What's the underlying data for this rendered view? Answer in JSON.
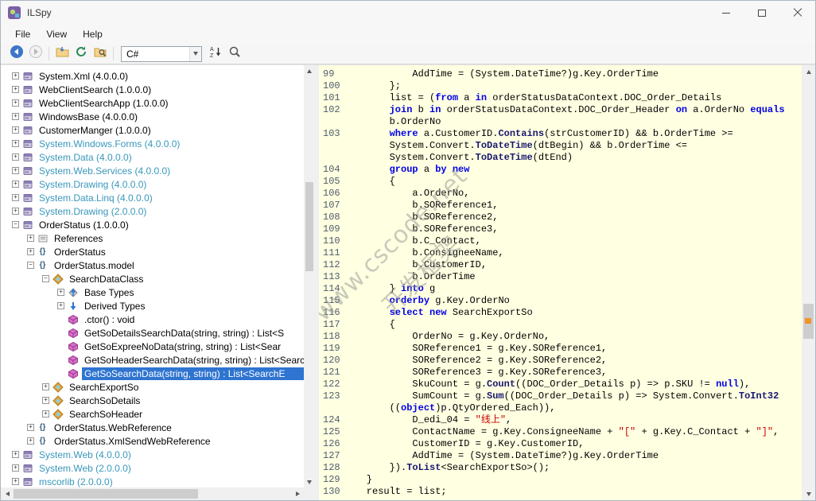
{
  "window": {
    "title": "ILSpy"
  },
  "menu": {
    "items": [
      "File",
      "View",
      "Help"
    ]
  },
  "toolbar": {
    "language": "C#"
  },
  "watermark": {
    "line1": "www.cscode.net",
    "line2": "开发框架"
  },
  "tree": {
    "items": [
      {
        "indent": 0,
        "exp": "+",
        "icon": "assembly",
        "label": "System.Xml (4.0.0.0)"
      },
      {
        "indent": 0,
        "exp": "+",
        "icon": "assembly",
        "label": "WebClientSearch (1.0.0.0)"
      },
      {
        "indent": 0,
        "exp": "+",
        "icon": "assembly",
        "label": "WebClientSearchApp (1.0.0.0)"
      },
      {
        "indent": 0,
        "exp": "+",
        "icon": "assembly",
        "label": "WindowsBase (4.0.0.0)"
      },
      {
        "indent": 0,
        "exp": "+",
        "icon": "assembly",
        "label": "CustomerManger (1.0.0.0)"
      },
      {
        "indent": 0,
        "exp": "+",
        "icon": "assembly",
        "label": "System.Windows.Forms (4.0.0.0)",
        "teal": true
      },
      {
        "indent": 0,
        "exp": "+",
        "icon": "assembly",
        "label": "System.Data (4.0.0.0)",
        "teal": true
      },
      {
        "indent": 0,
        "exp": "+",
        "icon": "assembly",
        "label": "System.Web.Services (4.0.0.0)",
        "teal": true
      },
      {
        "indent": 0,
        "exp": "+",
        "icon": "assembly",
        "label": "System.Drawing (4.0.0.0)",
        "teal": true
      },
      {
        "indent": 0,
        "exp": "+",
        "icon": "assembly",
        "label": "System.Data.Linq (4.0.0.0)",
        "teal": true
      },
      {
        "indent": 0,
        "exp": "+",
        "icon": "assembly",
        "label": "System.Drawing (2.0.0.0)",
        "teal": true
      },
      {
        "indent": 0,
        "exp": "-",
        "icon": "assembly",
        "label": "OrderStatus (1.0.0.0)"
      },
      {
        "indent": 1,
        "exp": "+",
        "icon": "references",
        "label": "References"
      },
      {
        "indent": 1,
        "exp": "+",
        "icon": "namespace",
        "label": "OrderStatus"
      },
      {
        "indent": 1,
        "exp": "-",
        "icon": "namespace",
        "label": "OrderStatus.model"
      },
      {
        "indent": 2,
        "exp": "-",
        "icon": "class",
        "label": "SearchDataClass"
      },
      {
        "indent": 3,
        "exp": "+",
        "icon": "base-types",
        "label": "Base Types"
      },
      {
        "indent": 3,
        "exp": "+",
        "icon": "derived-types",
        "label": "Derived Types"
      },
      {
        "indent": 3,
        "exp": null,
        "icon": "method",
        "label": ".ctor() : void"
      },
      {
        "indent": 3,
        "exp": null,
        "icon": "method",
        "label": "GetSoDetailsSearchData(string, string) : List<S"
      },
      {
        "indent": 3,
        "exp": null,
        "icon": "method",
        "label": "GetSoExpreeNoData(string, string) : List<Sear"
      },
      {
        "indent": 3,
        "exp": null,
        "icon": "method",
        "label": "GetSoHeaderSearchData(string, string) : List<Searc"
      },
      {
        "indent": 3,
        "exp": null,
        "icon": "method",
        "label": "GetSoSearchData(string, string) : List<SearchE",
        "selected": true
      },
      {
        "indent": 2,
        "exp": "+",
        "icon": "class",
        "label": "SearchExportSo"
      },
      {
        "indent": 2,
        "exp": "+",
        "icon": "class",
        "label": "SearchSoDetails"
      },
      {
        "indent": 2,
        "exp": "+",
        "icon": "class",
        "label": "SearchSoHeader"
      },
      {
        "indent": 1,
        "exp": "+",
        "icon": "namespace",
        "label": "OrderStatus.WebReference"
      },
      {
        "indent": 1,
        "exp": "+",
        "icon": "namespace",
        "label": "OrderStatus.XmlSendWebReference"
      },
      {
        "indent": 0,
        "exp": "+",
        "icon": "assembly",
        "label": "System.Web (4.0.0.0)",
        "teal": true
      },
      {
        "indent": 0,
        "exp": "+",
        "icon": "assembly",
        "label": "System.Web (2.0.0.0)",
        "teal": true
      },
      {
        "indent": 0,
        "exp": "+",
        "icon": "assembly",
        "label": "mscorlib (2.0.0.0)",
        "teal": true
      }
    ]
  },
  "code": {
    "lines": [
      {
        "n": "99",
        "t": [
          [
            "p",
            "            AddTime = (System.DateTime?)g.Key.OrderTime"
          ]
        ]
      },
      {
        "n": "100",
        "t": [
          [
            "p",
            "        };"
          ]
        ]
      },
      {
        "n": "101",
        "t": [
          [
            "p",
            "        list = ("
          ],
          [
            "k",
            "from"
          ],
          [
            "p",
            " a "
          ],
          [
            "k",
            "in"
          ],
          [
            "p",
            " orderStatusDataContext.DOC_Order_Details"
          ]
        ]
      },
      {
        "n": "102",
        "t": [
          [
            "p",
            "        "
          ],
          [
            "k",
            "join"
          ],
          [
            "p",
            " b "
          ],
          [
            "k",
            "in"
          ],
          [
            "p",
            " orderStatusDataContext.DOC_Order_Header "
          ],
          [
            "k",
            "on"
          ],
          [
            "p",
            " a.OrderNo "
          ],
          [
            "k",
            "equals"
          ]
        ]
      },
      {
        "n": null,
        "t": [
          [
            "p",
            "        b.OrderNo"
          ]
        ]
      },
      {
        "n": "103",
        "t": [
          [
            "p",
            "        "
          ],
          [
            "k",
            "where"
          ],
          [
            "p",
            " a.CustomerID."
          ],
          [
            "m",
            "Contains"
          ],
          [
            "p",
            "(strCustomerID) && b.OrderTime >="
          ]
        ]
      },
      {
        "n": null,
        "t": [
          [
            "p",
            "        System.Convert."
          ],
          [
            "m",
            "ToDateTime"
          ],
          [
            "p",
            "(dtBegin) && b.OrderTime <="
          ]
        ]
      },
      {
        "n": null,
        "t": [
          [
            "p",
            "        System.Convert."
          ],
          [
            "m",
            "ToDateTime"
          ],
          [
            "p",
            "(dtEnd)"
          ]
        ]
      },
      {
        "n": "104",
        "t": [
          [
            "p",
            "        "
          ],
          [
            "k",
            "group"
          ],
          [
            "p",
            " a "
          ],
          [
            "k",
            "by"
          ],
          [
            "p",
            " "
          ],
          [
            "k",
            "new"
          ]
        ]
      },
      {
        "n": "105",
        "t": [
          [
            "p",
            "        {"
          ]
        ]
      },
      {
        "n": "106",
        "t": [
          [
            "p",
            "            a.OrderNo,"
          ]
        ]
      },
      {
        "n": "107",
        "t": [
          [
            "p",
            "            b.SOReference1,"
          ]
        ]
      },
      {
        "n": "108",
        "t": [
          [
            "p",
            "            b.SOReference2,"
          ]
        ]
      },
      {
        "n": "109",
        "t": [
          [
            "p",
            "            b.SOReference3,"
          ]
        ]
      },
      {
        "n": "110",
        "t": [
          [
            "p",
            "            b.C_Contact,"
          ]
        ]
      },
      {
        "n": "111",
        "t": [
          [
            "p",
            "            b.ConsigneeName,"
          ]
        ]
      },
      {
        "n": "112",
        "t": [
          [
            "p",
            "            b.CustomerID,"
          ]
        ]
      },
      {
        "n": "113",
        "t": [
          [
            "p",
            "            b.OrderTime"
          ]
        ]
      },
      {
        "n": "114",
        "t": [
          [
            "p",
            "        } "
          ],
          [
            "k",
            "into"
          ],
          [
            "p",
            " g"
          ]
        ]
      },
      {
        "n": "115",
        "t": [
          [
            "p",
            "        "
          ],
          [
            "k",
            "orderby"
          ],
          [
            "p",
            " g.Key.OrderNo"
          ]
        ]
      },
      {
        "n": "116",
        "t": [
          [
            "p",
            "        "
          ],
          [
            "k",
            "select"
          ],
          [
            "p",
            " "
          ],
          [
            "k",
            "new"
          ],
          [
            "p",
            " SearchExportSo"
          ]
        ]
      },
      {
        "n": "117",
        "t": [
          [
            "p",
            "        {"
          ]
        ]
      },
      {
        "n": "118",
        "t": [
          [
            "p",
            "            OrderNo = g.Key.OrderNo,"
          ]
        ]
      },
      {
        "n": "119",
        "t": [
          [
            "p",
            "            SOReference1 = g.Key.SOReference1,"
          ]
        ]
      },
      {
        "n": "120",
        "t": [
          [
            "p",
            "            SOReference2 = g.Key.SOReference2,"
          ]
        ]
      },
      {
        "n": "121",
        "t": [
          [
            "p",
            "            SOReference3 = g.Key.SOReference3,"
          ]
        ]
      },
      {
        "n": "122",
        "t": [
          [
            "p",
            "            SkuCount = g."
          ],
          [
            "m",
            "Count"
          ],
          [
            "p",
            "((DOC_Order_Details p) => p.SKU != "
          ],
          [
            "k",
            "null"
          ],
          [
            "p",
            "),"
          ]
        ]
      },
      {
        "n": "123",
        "t": [
          [
            "p",
            "            SumCount = g."
          ],
          [
            "m",
            "Sum"
          ],
          [
            "p",
            "((DOC_Order_Details p) => System.Convert."
          ],
          [
            "m",
            "ToInt32"
          ]
        ]
      },
      {
        "n": null,
        "t": [
          [
            "p",
            "        (("
          ],
          [
            "k",
            "object"
          ],
          [
            "p",
            ")p.QtyOrdered_Each)),"
          ]
        ]
      },
      {
        "n": "124",
        "t": [
          [
            "p",
            "            D_edi_04 = "
          ],
          [
            "s",
            "\"线上\""
          ],
          [
            "p",
            ","
          ]
        ]
      },
      {
        "n": "125",
        "t": [
          [
            "p",
            "            ContactName = g.Key.ConsigneeName + "
          ],
          [
            "s",
            "\"[\""
          ],
          [
            "p",
            " + g.Key.C_Contact + "
          ],
          [
            "s",
            "\"]\""
          ],
          [
            "p",
            ","
          ]
        ]
      },
      {
        "n": "126",
        "t": [
          [
            "p",
            "            CustomerID = g.Key.CustomerID,"
          ]
        ]
      },
      {
        "n": "127",
        "t": [
          [
            "p",
            "            AddTime = (System.DateTime?)g.Key.OrderTime"
          ]
        ]
      },
      {
        "n": "128",
        "t": [
          [
            "p",
            "        })."
          ],
          [
            "m",
            "ToList"
          ],
          [
            "p",
            "<SearchExportSo>();"
          ]
        ]
      },
      {
        "n": "129",
        "t": [
          [
            "p",
            "    }"
          ]
        ]
      },
      {
        "n": "130",
        "t": [
          [
            "p",
            "    result = list;"
          ]
        ]
      }
    ]
  }
}
